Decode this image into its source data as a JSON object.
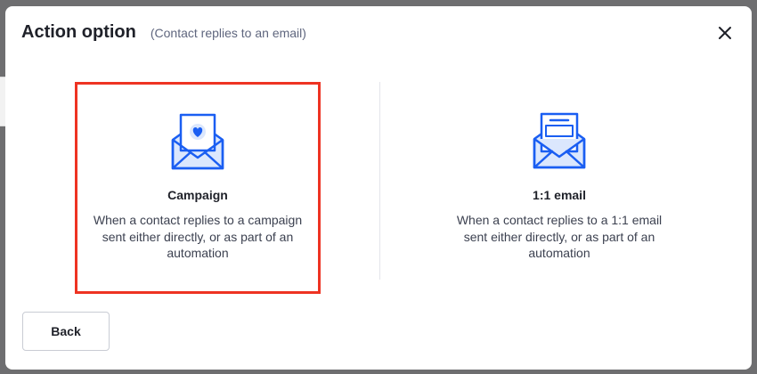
{
  "modal": {
    "title": "Action option",
    "subtitle": "(Contact replies to an email)",
    "close_icon": "close-icon"
  },
  "options": [
    {
      "label": "Campaign",
      "description": "When a contact replies to a campaign sent either directly, or as part of an automation",
      "icon": "envelope-heart-icon",
      "selected": true
    },
    {
      "label": "1:1 email",
      "description": "When a contact replies to a 1:1 email sent either directly, or as part of an automation",
      "icon": "envelope-letter-icon",
      "selected": false
    }
  ],
  "footer": {
    "back_label": "Back"
  },
  "colors": {
    "selection_border": "#ee3322",
    "icon_blue": "#1a5ef2",
    "icon_fill": "#dbe7fd"
  }
}
